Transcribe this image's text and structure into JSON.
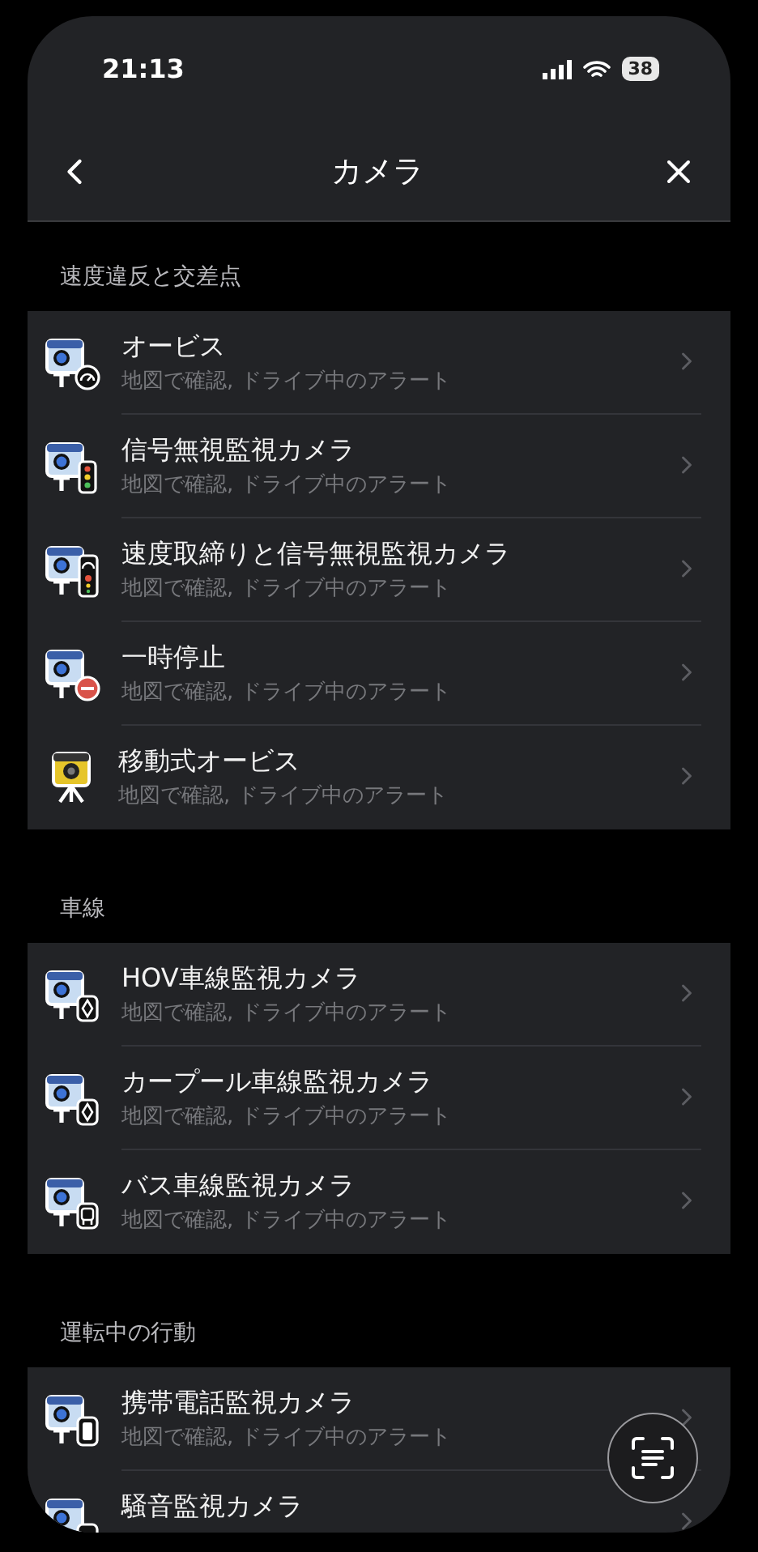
{
  "status_bar": {
    "time": "21:13",
    "battery": "38"
  },
  "header": {
    "title": "カメラ"
  },
  "sections": [
    {
      "title": "速度違反と交差点",
      "items": [
        {
          "title": "オービス",
          "subtitle": "地図で確認, ドライブ中のアラート",
          "kind": "speed"
        },
        {
          "title": "信号無視監視カメラ",
          "subtitle": "地図で確認, ドライブ中のアラート",
          "kind": "signal"
        },
        {
          "title": "速度取締りと信号無視監視カメラ",
          "subtitle": "地図で確認, ドライブ中のアラート",
          "kind": "speed_signal"
        },
        {
          "title": "一時停止",
          "subtitle": "地図で確認, ドライブ中のアラート",
          "kind": "stop"
        },
        {
          "title": "移動式オービス",
          "subtitle": "地図で確認, ドライブ中のアラート",
          "kind": "mobile"
        }
      ]
    },
    {
      "title": "車線",
      "items": [
        {
          "title": "HOV車線監視カメラ",
          "subtitle": "地図で確認, ドライブ中のアラート",
          "kind": "diamond"
        },
        {
          "title": "カープール車線監視カメラ",
          "subtitle": "地図で確認, ドライブ中のアラート",
          "kind": "diamond"
        },
        {
          "title": "バス車線監視カメラ",
          "subtitle": "地図で確認, ドライブ中のアラート",
          "kind": "bus"
        }
      ]
    },
    {
      "title": "運転中の行動",
      "items": [
        {
          "title": "携帯電話監視カメラ",
          "subtitle": "地図で確認, ドライブ中のアラート",
          "kind": "phone"
        },
        {
          "title": "騒音監視カメラ",
          "kind": "noise"
        }
      ]
    }
  ]
}
